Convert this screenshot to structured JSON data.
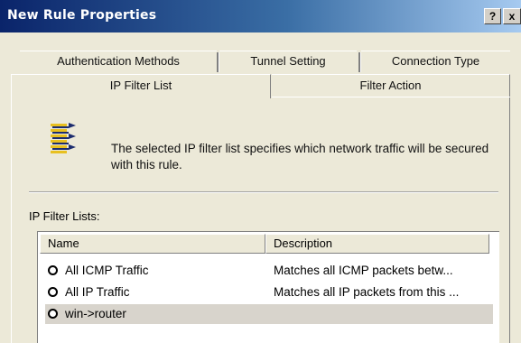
{
  "window": {
    "title": "New Rule Properties",
    "help_label": "?",
    "close_label": "x"
  },
  "tabs": {
    "back_row": [
      "Authentication Methods",
      "Tunnel Setting",
      "Connection Type"
    ],
    "front_row": [
      "IP Filter List",
      "Filter Action"
    ],
    "active": "IP Filter List"
  },
  "panel": {
    "description": "The selected IP filter list specifies which network traffic will be secured with this rule.",
    "lists_label": "IP Filter Lists:"
  },
  "table": {
    "columns": [
      "Name",
      "Description"
    ],
    "rows": [
      {
        "name": "All ICMP Traffic",
        "description": "Matches all ICMP packets betw...",
        "selected": false
      },
      {
        "name": "All IP Traffic",
        "description": "Matches all IP packets from this ...",
        "selected": false
      },
      {
        "name": "win->router",
        "description": "",
        "selected": false
      }
    ]
  },
  "colors": {
    "title_gradient_start": "#0a246a",
    "title_gradient_end": "#a6caf0",
    "dialog_face": "#ece9d8"
  },
  "icons": {
    "rule_icon": "filter-list-icon",
    "radio": "radio-button-icon"
  }
}
